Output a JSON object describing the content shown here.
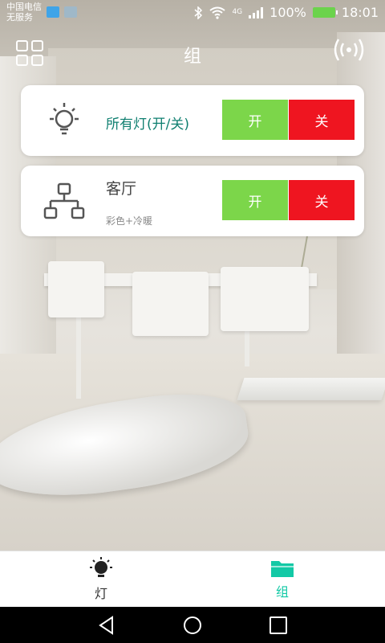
{
  "status_bar": {
    "carrier_line1": "中国电信",
    "carrier_line2": "无服务",
    "battery_percent": "100%",
    "time": "18:01",
    "network_label": "4G"
  },
  "header": {
    "title": "组",
    "menu_icon": "grid-icon",
    "right_icon": "signal-broadcast-icon"
  },
  "cards": [
    {
      "icon": "lightbulb-icon",
      "title": "所有灯(开/关)",
      "subtitle": "",
      "on_label": "开",
      "off_label": "关"
    },
    {
      "icon": "network-topology-icon",
      "title": "客厅",
      "subtitle": "彩色+冷暖",
      "on_label": "开",
      "off_label": "关"
    }
  ],
  "bottom_nav": {
    "items": [
      {
        "label": "灯",
        "icon": "lamp-icon",
        "active": false
      },
      {
        "label": "组",
        "icon": "folder-icon",
        "active": true
      }
    ]
  },
  "colors": {
    "accent": "#13c9a6",
    "on_button": "#7cd64a",
    "off_button": "#ef1520",
    "title_teal": "#0f7f70"
  }
}
